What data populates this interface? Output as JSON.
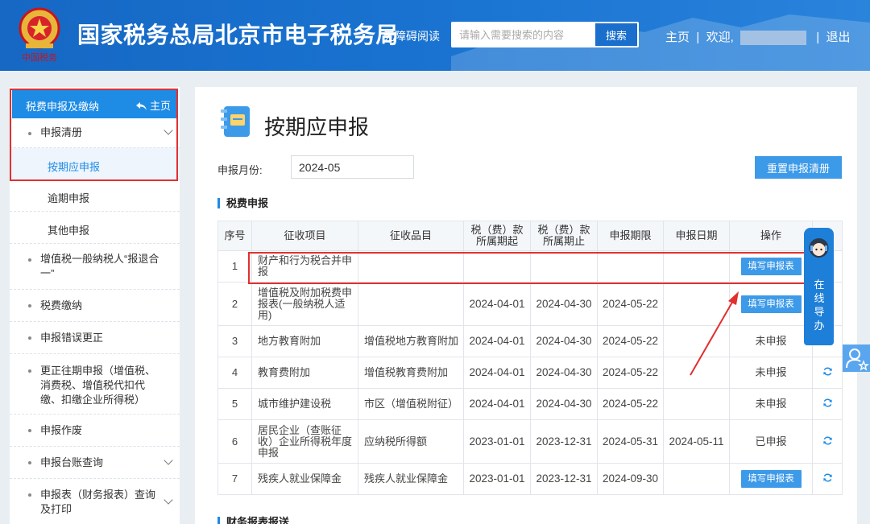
{
  "header": {
    "site_title": "国家税务总局北京市电子税务局",
    "a11y_link": "无障碍阅读",
    "search_placeholder": "请输入需要搜索的内容",
    "search_button": "搜索",
    "home_link": "主页",
    "welcome_text": "欢迎,",
    "logout_link": "退出",
    "brand_color": "#1a6fcc"
  },
  "sidebar": {
    "head_title": "税费申报及缴纳",
    "head_home": "主页",
    "items": [
      {
        "label": "申报清册",
        "has_arrow": true
      },
      {
        "label": "按期应申报",
        "active": true
      },
      {
        "label": "逾期申报"
      },
      {
        "label": "其他申报"
      },
      {
        "label": "增值税一般纳税人“报退合一”"
      },
      {
        "label": "税费缴纳"
      },
      {
        "label": "申报错误更正"
      },
      {
        "label": "更正往期申报（增值税、消费税、增值税代扣代缴、扣缴企业所得税）"
      },
      {
        "label": "申报作废"
      },
      {
        "label": "申报台账查询"
      },
      {
        "label": "申报表（财务报表）查询及打印"
      }
    ]
  },
  "main": {
    "page_title": "按期应申报",
    "month_label": "申报月份:",
    "month_value": "2024-05",
    "reset_button": "重置申报清册",
    "section_tax": "税费申报",
    "section_fin": "财务报表报送",
    "table": {
      "headers": [
        "序号",
        "征收项目",
        "征收品目",
        "税（费）款所属期起",
        "税（费）款所属期止",
        "申报期限",
        "申报日期",
        "操作",
        ""
      ],
      "rows": [
        {
          "no": "1",
          "item": "财产和行为税合并申报",
          "sub": "",
          "start": "",
          "end": "",
          "deadline": "",
          "date": "",
          "op": "填写申报表",
          "op_type": "button",
          "refresh": false
        },
        {
          "no": "2",
          "item": "增值税及附加税费申报表(一般纳税人适用)",
          "sub": "",
          "start": "2024-04-01",
          "end": "2024-04-30",
          "deadline": "2024-05-22",
          "date": "",
          "op": "填写申报表",
          "op_type": "button",
          "refresh": false
        },
        {
          "no": "3",
          "item": "地方教育附加",
          "sub": "增值税地方教育附加",
          "start": "2024-04-01",
          "end": "2024-04-30",
          "deadline": "2024-05-22",
          "date": "",
          "op": "未申报",
          "op_type": "text",
          "refresh": true
        },
        {
          "no": "4",
          "item": "教育费附加",
          "sub": "增值税教育费附加",
          "start": "2024-04-01",
          "end": "2024-04-30",
          "deadline": "2024-05-22",
          "date": "",
          "op": "未申报",
          "op_type": "text",
          "refresh": true
        },
        {
          "no": "5",
          "item": "城市维护建设税",
          "sub": "市区（增值税附征）",
          "start": "2024-04-01",
          "end": "2024-04-30",
          "deadline": "2024-05-22",
          "date": "",
          "op": "未申报",
          "op_type": "text",
          "refresh": true
        },
        {
          "no": "6",
          "item": "居民企业（查账征收）企业所得税年度申报",
          "sub": "应纳税所得额",
          "start": "2023-01-01",
          "end": "2023-12-31",
          "deadline": "2024-05-31",
          "date": "2024-05-11",
          "op": "已申报",
          "op_type": "text",
          "refresh": true
        },
        {
          "no": "7",
          "item": "残疾人就业保障金",
          "sub": "残疾人就业保障金",
          "start": "2023-01-01",
          "end": "2023-12-31",
          "deadline": "2024-09-30",
          "date": "",
          "op": "填写申报表",
          "op_type": "button",
          "refresh": true
        }
      ]
    }
  },
  "helper": {
    "text": "在线导办"
  }
}
